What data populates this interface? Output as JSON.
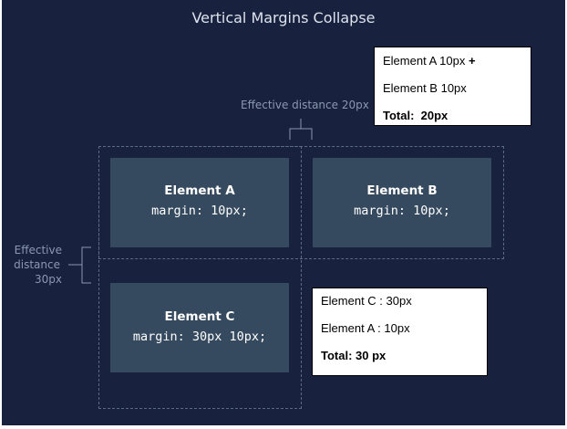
{
  "title": "Vertical Margins Collapse",
  "elements": {
    "a": {
      "name": "Element A",
      "rule": "margin: 10px;"
    },
    "b": {
      "name": "Element B",
      "rule": "margin: 10px;"
    },
    "c": {
      "name": "Element C",
      "rule": "margin: 30px 10px;"
    }
  },
  "annotations": {
    "horizontal": "Effective distance 20px",
    "vertical": [
      "Effective",
      "distance",
      "30px"
    ]
  },
  "callouts": {
    "top": {
      "line1": "Element A 10px",
      "line1_suffix": "+",
      "line2": "Element B 10px",
      "total": "Total:  20px"
    },
    "bottom": {
      "line1": "Element C : 30px",
      "line2": "Element A : 10px",
      "total": "Total: 30 px"
    }
  },
  "colors": {
    "background": "#18213d",
    "box": "#35495f",
    "dashed_outline": "#5b6b86",
    "annotation_text": "#8a99b1"
  }
}
